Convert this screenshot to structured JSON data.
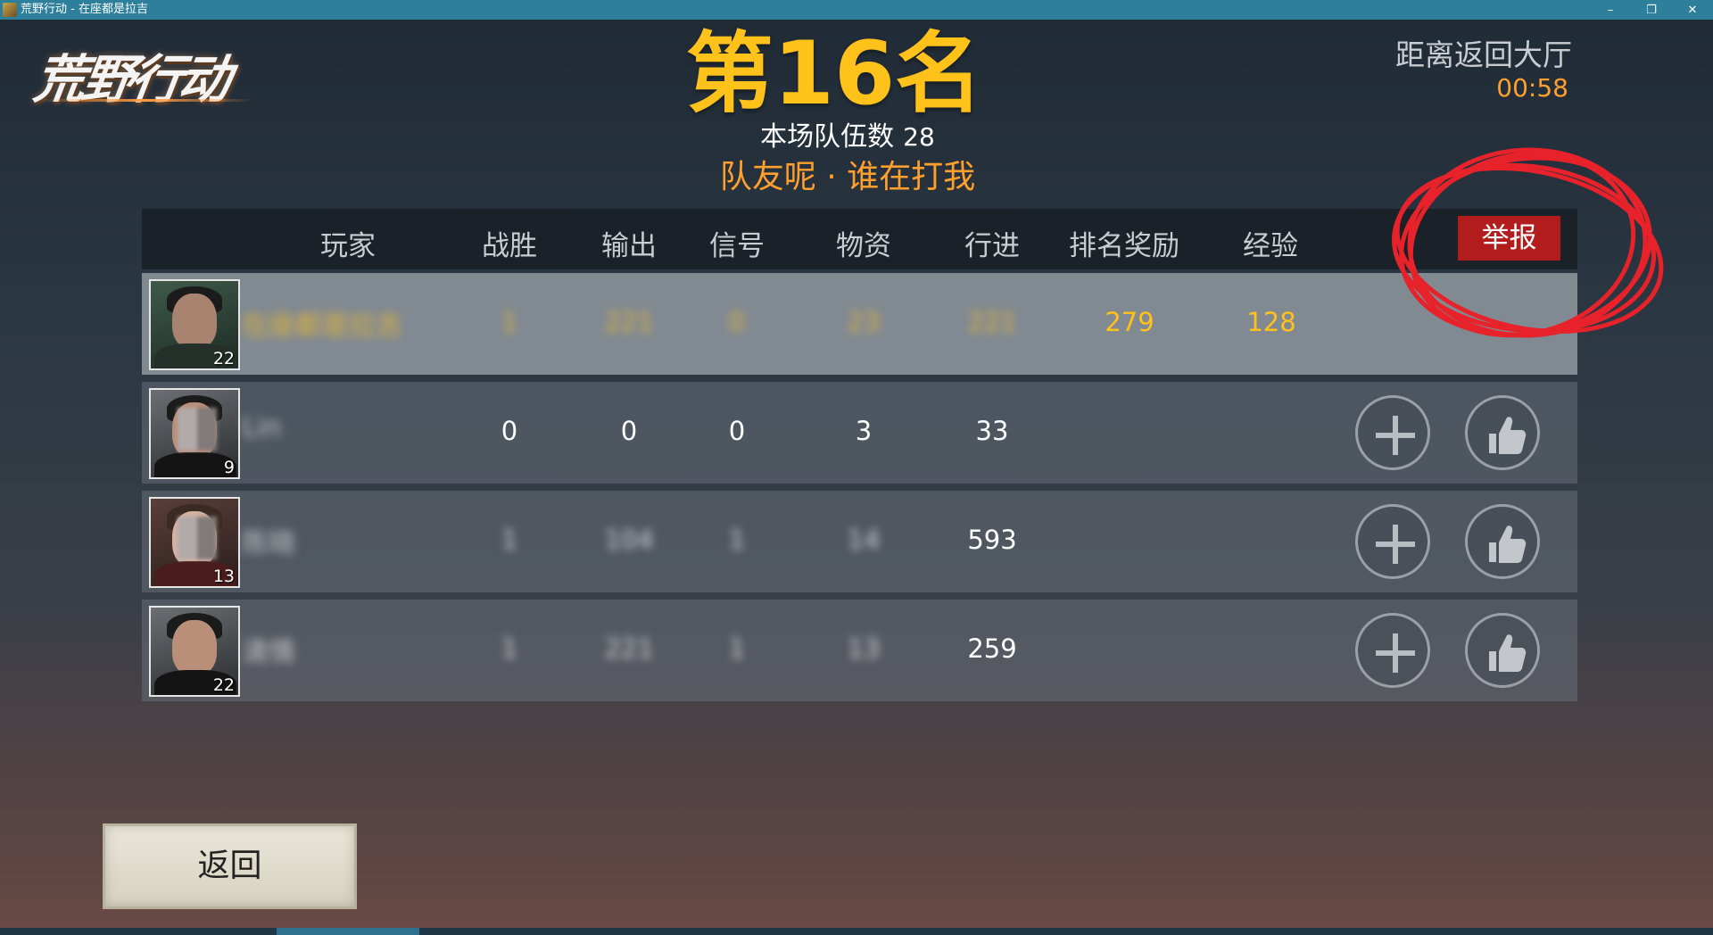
{
  "window": {
    "title": "荒野行动 - 在座都是拉吉",
    "minimize": "–",
    "restore": "❐",
    "close": "✕"
  },
  "logo_text": "荒野行动",
  "header": {
    "rank": "第16名",
    "team_count_label": "本场队伍数",
    "team_count": "28",
    "slogan": "队友呢 · 谁在打我",
    "return_label": "距离返回大厅",
    "countdown": "00:58"
  },
  "columns": [
    "玩家",
    "战胜",
    "输出",
    "信号",
    "物资",
    "行进",
    "排名奖励",
    "经验"
  ],
  "report_label": "举报",
  "rows": [
    {
      "level": "22",
      "name": "在座都是拉吉",
      "kills": "1",
      "damage": "221",
      "signal": "0",
      "supplies": "23",
      "travel": "221",
      "rank_reward": "279",
      "exp": "128",
      "self": true
    },
    {
      "level": "9",
      "name": "Lin",
      "kills": "0",
      "damage": "0",
      "signal": "0",
      "supplies": "3",
      "travel": "33",
      "rank_reward": "",
      "exp": "",
      "self": false
    },
    {
      "level": "13",
      "name": "陈晓",
      "kills": "1",
      "damage": "104",
      "signal": "1",
      "supplies": "14",
      "travel": "593",
      "rank_reward": "",
      "exp": "",
      "self": false
    },
    {
      "level": "22",
      "name": "清情",
      "kills": "1",
      "damage": "221",
      "signal": "1",
      "supplies": "13",
      "travel": "259",
      "rank_reward": "",
      "exp": "",
      "self": false
    }
  ],
  "icons": {
    "add_friend": "plus-icon",
    "like": "thumbs-up-icon"
  },
  "back_button": "返回",
  "colors": {
    "accent_gold": "#ffc21b",
    "accent_orange": "#ff9f2e",
    "report_red": "#b31c1c",
    "scribble_red": "#e8222a"
  }
}
